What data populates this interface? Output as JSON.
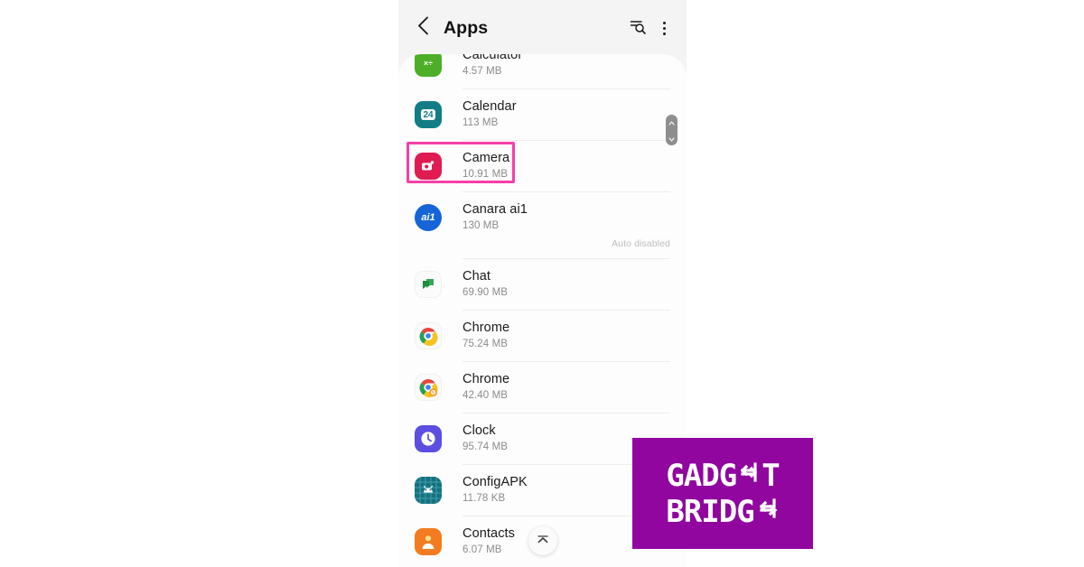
{
  "header": {
    "back_icon": "chevron-left-icon",
    "title": "Apps",
    "search_icon": "search-filter-icon",
    "menu_icon": "overflow-menu-icon"
  },
  "list": {
    "rows": [
      {
        "name": "Calculator",
        "size": "4.57 MB",
        "icon": "calculator-icon",
        "note": "",
        "clipped": true
      },
      {
        "name": "Calendar",
        "size": "113 MB",
        "icon": "calendar-icon",
        "note": ""
      },
      {
        "name": "Camera",
        "size": "10.91 MB",
        "icon": "camera-icon",
        "note": "",
        "highlighted": true
      },
      {
        "name": "Canara ai1",
        "size": "130 MB",
        "icon": "canara-icon",
        "note": "Auto disabled"
      },
      {
        "name": "Chat",
        "size": "69.90 MB",
        "icon": "chat-icon",
        "note": ""
      },
      {
        "name": "Chrome",
        "size": "75.24 MB",
        "icon": "chrome-icon",
        "note": ""
      },
      {
        "name": "Chrome",
        "size": "42.40 MB",
        "icon": "chrome-beta-icon",
        "note": ""
      },
      {
        "name": "Clock",
        "size": "95.74 MB",
        "icon": "clock-icon",
        "note": ""
      },
      {
        "name": "ConfigAPK",
        "size": "11.78 KB",
        "icon": "configapk-icon",
        "note": ""
      },
      {
        "name": "Contacts",
        "size": "6.07 MB",
        "icon": "contacts-icon",
        "note": ""
      }
    ]
  },
  "icon_glyphs": {
    "calculator": "×÷",
    "calendar": "24",
    "canara": "ai1"
  },
  "scrollbar": {
    "name": "list-scrollbar-thumb"
  },
  "fab": {
    "name": "scroll-to-top-button",
    "icon": "chevron-up-icon"
  },
  "highlight": {
    "target": "Camera",
    "color": "#f73fa8"
  },
  "watermark": {
    "line1": "GADG",
    "line1_end": "T",
    "line2": "BRIDG",
    "background": "#90069f",
    "text_color": "#ffffff"
  }
}
